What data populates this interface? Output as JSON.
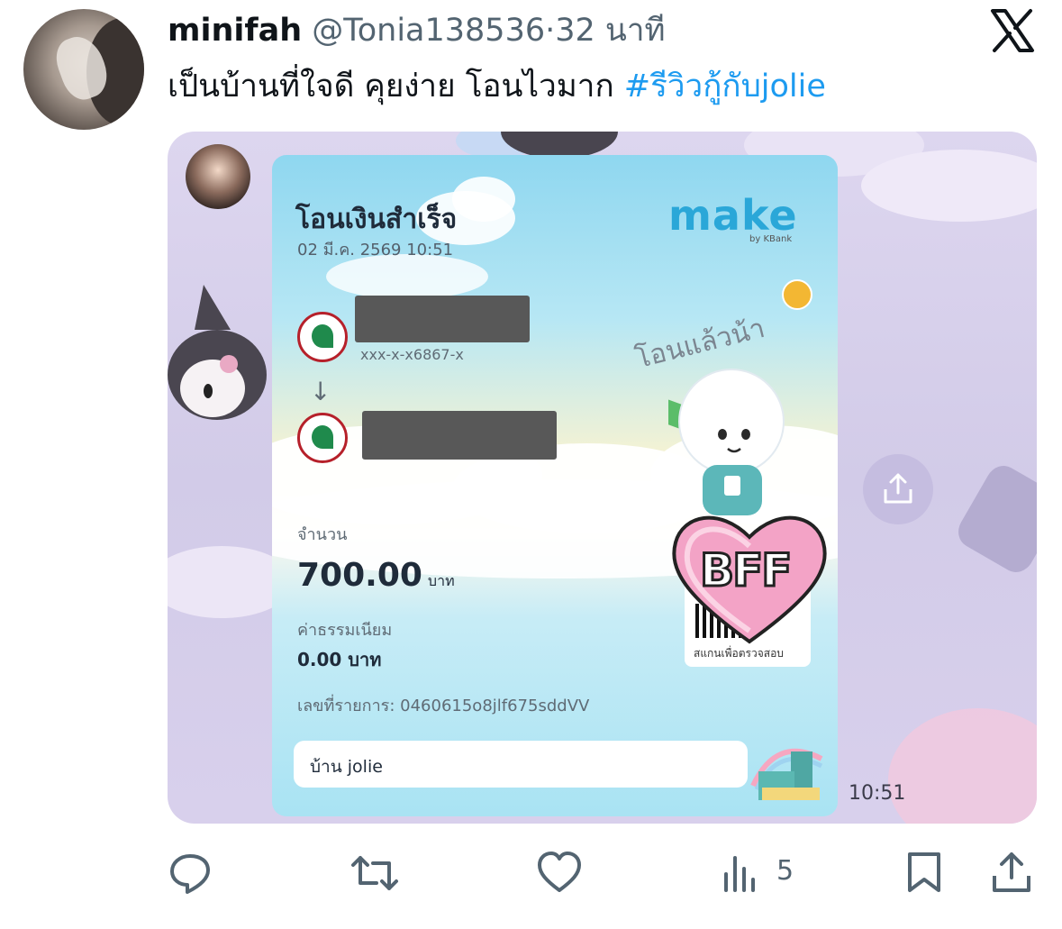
{
  "tweet": {
    "author_name": "minifah",
    "author_handle": "@Tonia138536",
    "separator": "·",
    "time_ago": "32 นาที",
    "text": "เป็นบ้านที่ใจดี คุยง่าย โอนไวมาก ",
    "hashtag": "#รีวิวกู้กับjolie"
  },
  "media": {
    "slip": {
      "title": "โอนเงินสำเร็จ",
      "date": "02 มี.ค. 2569 10:51",
      "brand": "make",
      "brand_sub": "by KBank",
      "from_account": "xxx-x-x6867-x",
      "arrow": "↓",
      "amount_label": "จำนวน",
      "amount": "700.00",
      "amount_unit": "บาท",
      "fee_label": "ค่าธรรมเนียม",
      "fee": "0.00 บาท",
      "ref_label": "เลขที่รายการ: 0460615o8jlf675sddVV",
      "memo": "บ้าน jolie",
      "sticker_text": "โอนแล้วน้า",
      "qr_caption": "สแกนเพื่อตรวจสอบ",
      "badge": "BFF"
    },
    "time": "10:51"
  },
  "actions": {
    "views": "5"
  },
  "colors": {
    "accent": "#1d9bf0",
    "text": "#0f1419",
    "muted": "#536471"
  }
}
